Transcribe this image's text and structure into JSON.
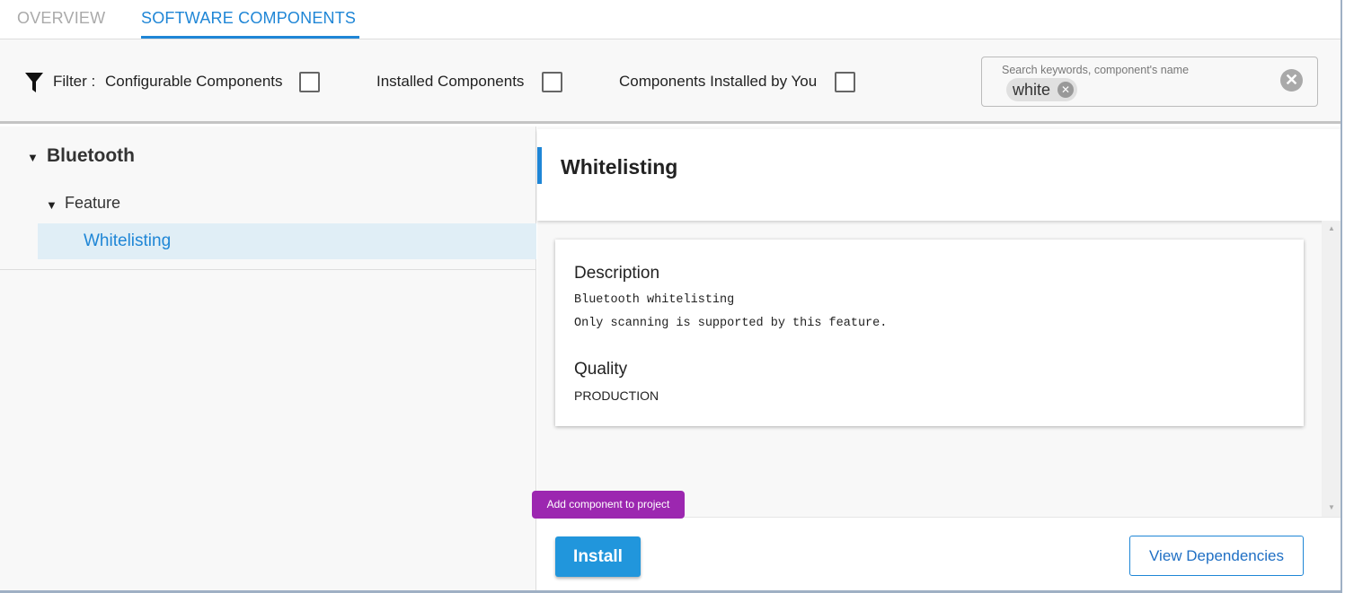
{
  "tabs": [
    {
      "label": "OVERVIEW",
      "active": false
    },
    {
      "label": "SOFTWARE COMPONENTS",
      "active": true
    }
  ],
  "filter": {
    "label": "Filter :",
    "options": [
      {
        "label": "Configurable Components",
        "checked": false
      },
      {
        "label": "Installed Components",
        "checked": false
      },
      {
        "label": "Components Installed by You",
        "checked": false
      }
    ]
  },
  "search": {
    "placeholder": "Search keywords, component's name",
    "chips": [
      "white"
    ]
  },
  "tree": {
    "root": "Bluetooth",
    "category": "Feature",
    "items": [
      {
        "label": "Whitelisting",
        "selected": true
      }
    ]
  },
  "detail": {
    "title": "Whitelisting",
    "description_heading": "Description",
    "description_lines": [
      "Bluetooth whitelisting",
      "Only scanning is supported by this feature."
    ],
    "quality_heading": "Quality",
    "quality": "PRODUCTION"
  },
  "footer": {
    "install_label": "Install",
    "view_dependencies_label": "View Dependencies",
    "tooltip": "Add component to project"
  },
  "colors": {
    "accent": "#1f86d6",
    "tooltip": "#9c27b0",
    "install": "#2196dc"
  }
}
